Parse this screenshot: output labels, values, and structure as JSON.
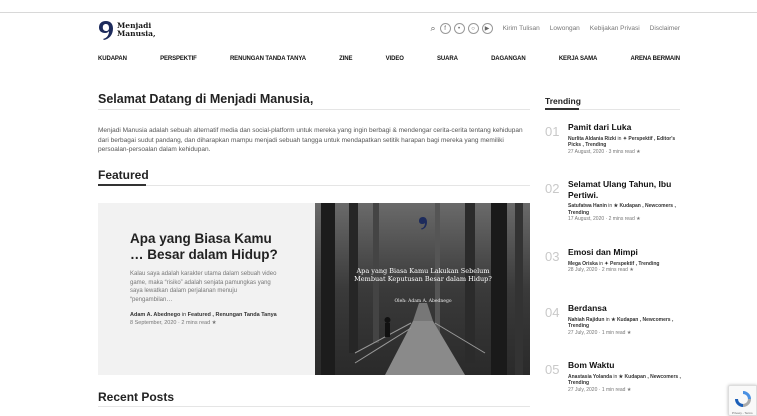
{
  "header": {
    "logo_line1": "Menjadi",
    "logo_line2": "Manusia,",
    "social_icons": [
      "search-icon",
      "facebook-icon",
      "twitter-icon",
      "instagram-icon",
      "youtube-icon"
    ],
    "links": [
      "Kirim Tulisan",
      "Lowongan",
      "Kebijakan Privasi",
      "Disclaimer"
    ]
  },
  "nav": [
    "KUDAPAN",
    "PERSPEKTIF",
    "RENUNGAN TANDA TANYA",
    "ZINE",
    "VIDEO",
    "SUARA",
    "DAGANGAN",
    "KERJA SAMA",
    "ARENA BERMAIN"
  ],
  "welcome": {
    "title": "Selamat Datang di Menjadi Manusia,",
    "text": "Menjadi Manusia adalah sebuah alternatif media dan social-platform untuk mereka yang ingin berbagi & mendengar cerita-cerita tentang kehidupan dari berbagai sudut pandang, dan diharapkan mampu menjadi sebuah tangga untuk mendapatkan setitik harapan bagi mereka yang memiliki persoalan-persoalan dalam kehidupan."
  },
  "featured": {
    "section_title": "Featured",
    "title": "Apa yang Biasa Kamu … Besar dalam Hidup?",
    "excerpt": "Kalau saya adalah karakter utama dalam sebuah video game, maka “risiko” adalah senjata pamungkas yang saya lewatkan dalam perjalanan menuju “pengambilan…",
    "author": "Adam A. Abednego",
    "in_word": "in",
    "categories": "Featured , Renungan Tanda Tanya",
    "date": "8 September, 2020",
    "read": "2 mins read",
    "image_title": "Apa yang Biasa Kamu Lakukan Sebelum Membuat Keputusan Besar dalam Hidup?",
    "image_byline": "Oleh: Adam A. Abednego"
  },
  "recent": {
    "section_title": "Recent Posts"
  },
  "trending": {
    "section_title": "Trending",
    "items": [
      {
        "num": "01",
        "title": "Pamit dari Luka",
        "author": "Nurlita Aldania Rizki",
        "cats": "✦ Perspektif , Editor's Picks , Trending",
        "date": "27 August, 2020",
        "read": "3 mins read"
      },
      {
        "num": "02",
        "title": "Selamat Ulang Tahun, Ibu Pertiwi.",
        "author": "Satufatwa Hanin",
        "cats": "★ Kudapan , Newcomers , Trending",
        "date": "17 August, 2020",
        "read": "2 mins read"
      },
      {
        "num": "03",
        "title": "Emosi dan Mimpi",
        "author": "Mega Oriska",
        "cats": "✦ Perspektif , Trending",
        "date": "28 July, 2020",
        "read": "2 mins read"
      },
      {
        "num": "04",
        "title": "Berdansa",
        "author": "Nahiah Rajidun",
        "cats": "★ Kudapan , Newcomers , Trending",
        "date": "27 July, 2020",
        "read": "1 min read"
      },
      {
        "num": "05",
        "title": "Bom Waktu",
        "author": "Anastasia Yolanda",
        "cats": "★ Kudapan , Newcomers , Trending",
        "date": "27 July, 2020",
        "read": "1 min read"
      }
    ]
  },
  "recaptcha": {
    "text": "Privacy - Terms"
  },
  "colors": {
    "text": "#222222",
    "muted": "#777777",
    "card_bg": "#f2f2f2",
    "number": "#c9c9c9"
  }
}
